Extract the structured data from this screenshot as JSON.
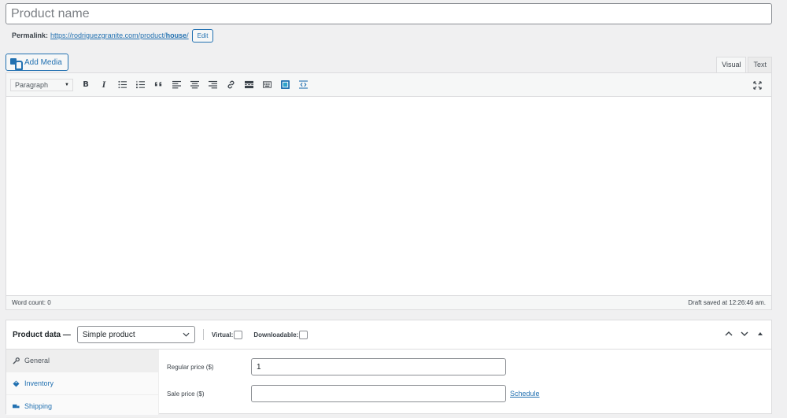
{
  "title": {
    "placeholder": "Product name",
    "value": ""
  },
  "permalink": {
    "label": "Permalink:",
    "url_base": "https://rodriguezgranite.com/product/",
    "slug": "house",
    "url_end": "/",
    "edit_label": "Edit"
  },
  "media": {
    "add_media_label": "Add Media"
  },
  "editor_tabs": {
    "visual": "Visual",
    "text": "Text"
  },
  "toolbar": {
    "format": "Paragraph",
    "bold": "B",
    "italic": "I",
    "quote": "“"
  },
  "status": {
    "word_count": "Word count: 0",
    "draft_saved": "Draft saved at 12:26:46 am."
  },
  "product_data": {
    "title": "Product data —",
    "type": "Simple product",
    "virtual_label": "Virtual:",
    "downloadable_label": "Downloadable:",
    "tabs": [
      {
        "label": "General",
        "icon": "wrench-icon"
      },
      {
        "label": "Inventory",
        "icon": "tag-icon"
      },
      {
        "label": "Shipping",
        "icon": "truck-icon"
      }
    ],
    "regular_price_label": "Regular price ($)",
    "regular_price_value": "1",
    "sale_price_label": "Sale price ($)",
    "sale_price_value": "",
    "schedule_label": "Schedule"
  }
}
